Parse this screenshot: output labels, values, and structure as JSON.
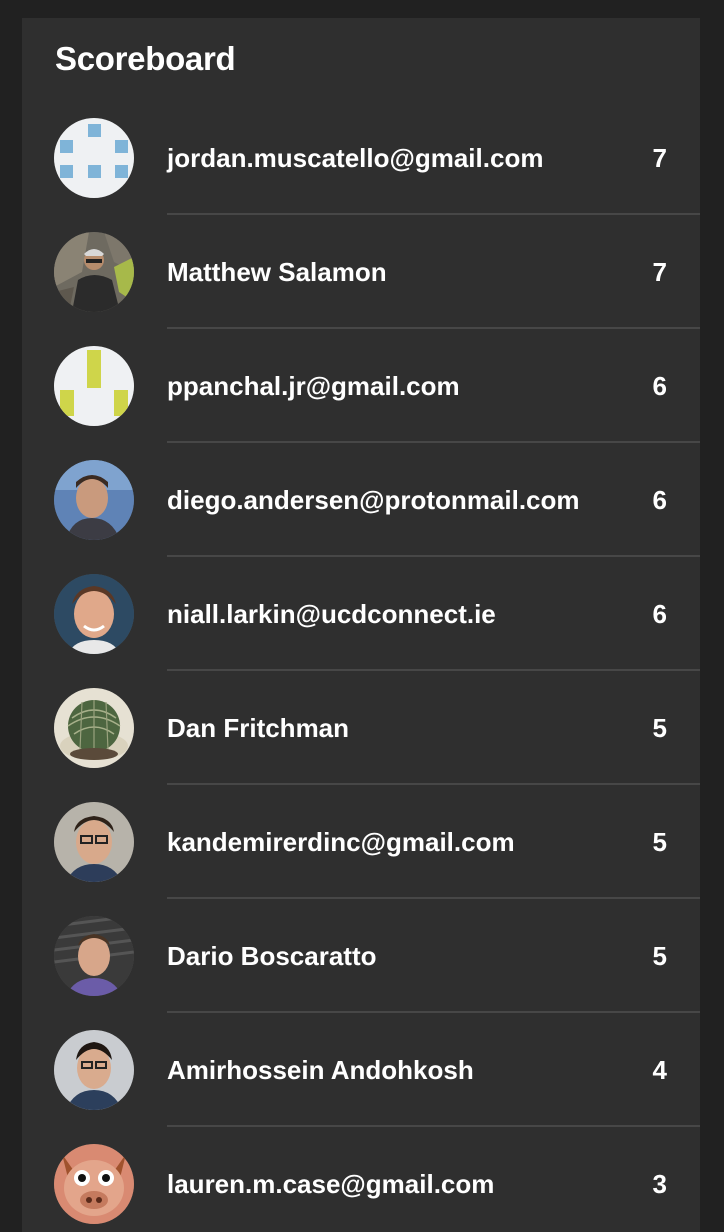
{
  "scoreboard": {
    "title": "Scoreboard",
    "entries": [
      {
        "name": "jordan.muscatello@gmail.com",
        "score": "7",
        "avatar_icon": "identicon-blue-avatar"
      },
      {
        "name": "Matthew Salamon",
        "score": "7",
        "avatar_icon": "climber-photo-avatar"
      },
      {
        "name": "ppanchal.jr@gmail.com",
        "score": "6",
        "avatar_icon": "identicon-yellow-avatar"
      },
      {
        "name": "diego.andersen@protonmail.com",
        "score": "6",
        "avatar_icon": "profile-photo-avatar"
      },
      {
        "name": "niall.larkin@ucdconnect.ie",
        "score": "6",
        "avatar_icon": "profile-photo-avatar"
      },
      {
        "name": "Dan Fritchman",
        "score": "5",
        "avatar_icon": "cactus-photo-avatar"
      },
      {
        "name": "kandemirerdinc@gmail.com",
        "score": "5",
        "avatar_icon": "profile-photo-avatar"
      },
      {
        "name": "Dario Boscaratto",
        "score": "5",
        "avatar_icon": "profile-photo-avatar"
      },
      {
        "name": "Amirhossein Andohkosh",
        "score": "4",
        "avatar_icon": "profile-photo-avatar"
      },
      {
        "name": "lauren.m.case@gmail.com",
        "score": "3",
        "avatar_icon": "pig-mask-photo-avatar"
      }
    ]
  }
}
